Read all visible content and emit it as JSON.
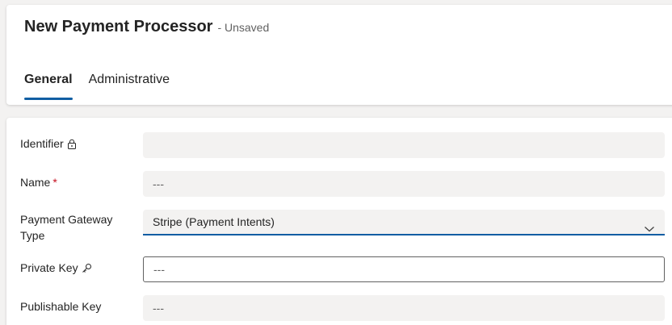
{
  "header": {
    "title": "New Payment Processor",
    "subtitle": "- Unsaved",
    "tabs": [
      {
        "label": "General",
        "active": true
      },
      {
        "label": "Administrative",
        "active": false
      }
    ]
  },
  "form": {
    "fields": [
      {
        "label": "Identifier",
        "icon": "lock-icon",
        "value": ""
      },
      {
        "label": "Name",
        "required_marker": "*",
        "value": "---"
      },
      {
        "label": "Payment Gateway Type",
        "value": "Stripe (Payment Intents)",
        "icon": "chevron-down-icon"
      },
      {
        "label": "Private Key",
        "icon": "key-icon",
        "value": "---"
      },
      {
        "label": "Publishable Key",
        "value": "---"
      }
    ]
  },
  "colors": {
    "accent": "#115ea3",
    "required": "#c50f1f",
    "field_bg": "#f3f2f1"
  }
}
